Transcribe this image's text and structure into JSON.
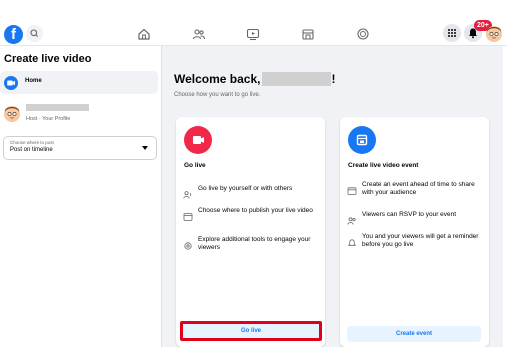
{
  "colors": {
    "brand_blue": "#1877f2",
    "go_live_red": "#f02849",
    "highlight_red": "#e0001a",
    "notification_red": "#e41e3f"
  },
  "topnav": {
    "logo_icon": "facebook-logo-icon",
    "logo_letter": "f",
    "search_icon": "search-icon",
    "nav_icons": [
      "home-icon",
      "friends-icon",
      "watch-icon",
      "marketplace-icon",
      "gaming-icon"
    ],
    "right_icons": [
      "menu-grid-icon",
      "notifications-icon"
    ],
    "notification_badge": "20+"
  },
  "sidebar": {
    "title": "Create live video",
    "home_label": "Home",
    "host_subtitle": "Host · Your Profile",
    "select": {
      "label": "Choose where to post",
      "value": "Post on timeline"
    }
  },
  "main": {
    "welcome": "Welcome back,",
    "welcome_suffix": "!",
    "subtitle": "Choose how you want to go live."
  },
  "go_live_card": {
    "title": "Go live",
    "features": [
      {
        "icon": "person-live-icon",
        "text": "Go live by yourself or with others"
      },
      {
        "icon": "window-icon",
        "text": "Choose where to publish your live video"
      },
      {
        "icon": "tools-gear-icon",
        "text": "Explore additional tools to engage your viewers"
      }
    ],
    "button": "Go live"
  },
  "event_card": {
    "title": "Create live video event",
    "features": [
      {
        "icon": "calendar-icon",
        "text": "Create an event ahead of time to share with your audience"
      },
      {
        "icon": "people-icon",
        "text": "Viewers can RSVP to your event"
      },
      {
        "icon": "bell-icon",
        "text": "You and your viewers will get a reminder before you go live"
      }
    ],
    "button": "Create event"
  }
}
